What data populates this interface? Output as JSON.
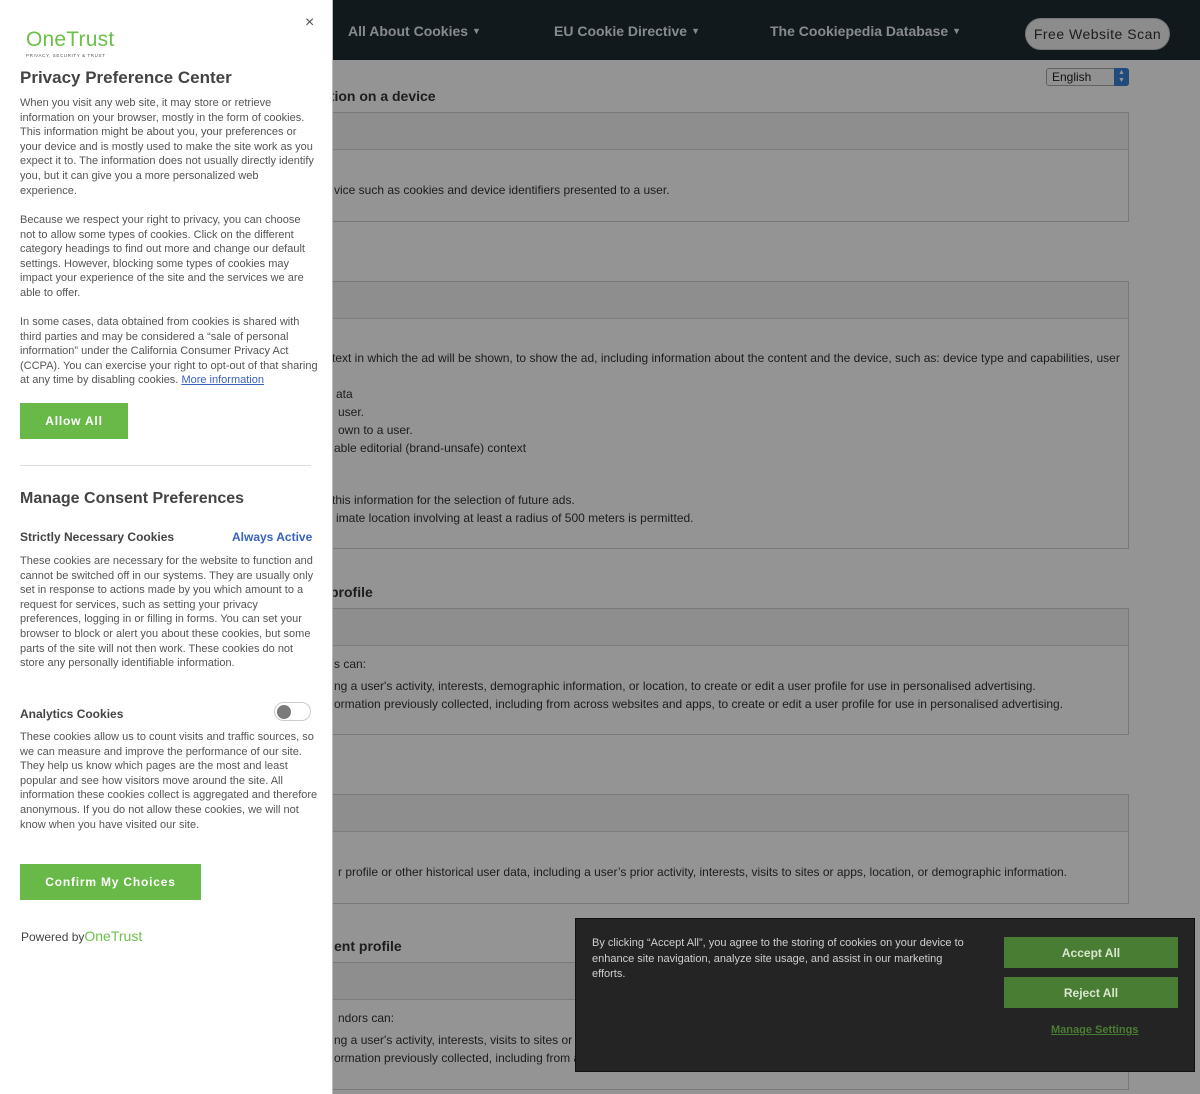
{
  "nav": {
    "items": [
      {
        "label": "All About Cookies"
      },
      {
        "label": "EU Cookie Directive"
      },
      {
        "label": "The Cookiepedia Database"
      }
    ],
    "scan_button": "Free Website Scan"
  },
  "language": {
    "selected": "English"
  },
  "content": {
    "headings": [
      "ation on a device",
      "profile",
      "ent profile"
    ],
    "lines": [
      "vice such as cookies and device identifiers presented to a user.",
      "text in which the ad will be shown, to show the ad, including information about the content and the device, such as: device type and capabilities, user",
      "ata",
      "user.",
      "own to a user.",
      "able editorial (brand-unsafe) context",
      "this information for the selection of future ads.",
      "imate location involving at least a radius of 500 meters is permitted.",
      "s can:",
      "ng a user's activity, interests, demographic information, or location, to create or edit a user profile for use in personalised advertising.",
      "ormation previously collected, including from across websites and apps, to create or edit a user profile for use in personalised advertising.",
      "r profile or other historical user data, including a user’s prior activity, interests, visits to sites or apps, location, or demographic information.",
      "ndors can:",
      "ng a user's activity, interests, visits to sites or a",
      "ormation previously collected, including from ac"
    ]
  },
  "pc": {
    "close": "×",
    "logo_word": "OneTrust",
    "logo_tagline": "PRIVACY, SECURITY & TRUST",
    "title": "Privacy Preference Center",
    "para1": "When you visit any web site, it may store or retrieve information on your browser, mostly in the form of cookies. This information might be about you, your preferences or your device and is mostly used to make the site work as you expect it to. The information does not usually directly identify you, but it can give you a more personalized web experience.",
    "para2": "Because we respect your right to privacy, you can choose not to allow some types of cookies. Click on the different category headings to find out more and change our default settings. However, blocking some types of cookies may impact your experience of the site and the services we are able to offer.",
    "para3": "In some cases, data obtained from cookies is shared with third parties and may be considered a “sale of personal information” under the California Consumer Privacy Act (CCPA). You can exercise your right to opt-out of that sharing at any time by disabling cookies.",
    "more_info": "More information",
    "allow_all": "Allow All",
    "manage_title": "Manage Consent Preferences",
    "strict_title": "Strictly Necessary Cookies",
    "always_active": "Always Active",
    "strict_desc": "These cookies are necessary for the website to function and cannot be switched off in our systems. They are usually only set in response to actions made by you which amount to a request for services, such as setting your privacy preferences, logging in or filling in forms.    You can set your browser to block or alert you about these cookies, but some parts of the site will not then work. These cookies do not store any personally identifiable information.",
    "analytics_title": "Analytics Cookies",
    "analytics_enabled": false,
    "analytics_desc": "These cookies allow us to count visits and traffic sources, so we can measure and improve the performance of our site. They help us know which pages are the most and least popular and see how visitors move around the site. All information these cookies collect is aggregated and therefore anonymous. If you do not allow these cookies, we will not know when you have visited our site.",
    "confirm": "Confirm My Choices",
    "powered_by": "Powered by",
    "powered_brand": "OneTrust"
  },
  "banner": {
    "text": "By clicking “Accept All”, you agree to the storing of cookies on your device to enhance site navigation, analyze site usage, and assist in our marketing efforts.",
    "accept": "Accept All",
    "reject": "Reject All",
    "manage": "Manage Settings"
  },
  "colors": {
    "brand_green": "#68b947",
    "banner_green": "#4a7d34",
    "link_blue": "#3860be",
    "nav_bg": "#1f2b33"
  }
}
